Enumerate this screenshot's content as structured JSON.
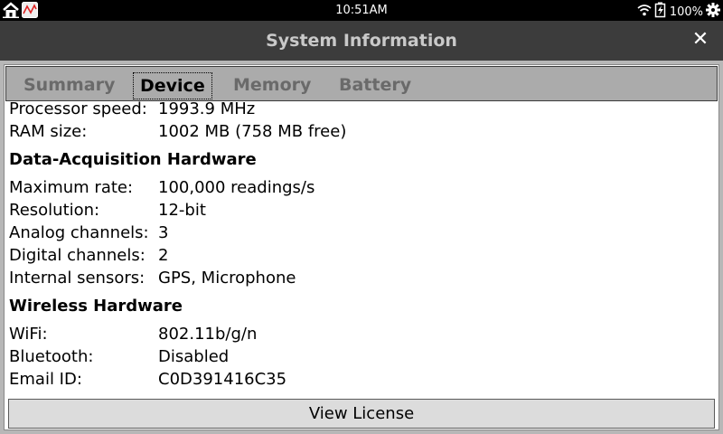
{
  "status_bar": {
    "time": "10:51AM",
    "battery_percent": "100%",
    "icons": [
      "home-icon",
      "chart-app-icon",
      "wifi-icon",
      "battery-charging-icon",
      "gear-icon"
    ]
  },
  "window": {
    "title": "System Information",
    "close_label": "✕"
  },
  "tabs": [
    {
      "label": "Summary",
      "active": false
    },
    {
      "label": "Device",
      "active": true
    },
    {
      "label": "Memory",
      "active": false
    },
    {
      "label": "Battery",
      "active": false
    }
  ],
  "device_info": {
    "processor_speed": {
      "label": "Processor speed:",
      "value": "1993.9 MHz"
    },
    "ram_size": {
      "label": "RAM size:",
      "value": "1002 MB (758 MB free)"
    },
    "daq_heading": "Data-Acquisition Hardware",
    "max_rate": {
      "label": "Maximum rate:",
      "value": "100,000 readings/s"
    },
    "resolution": {
      "label": "Resolution:",
      "value": "12-bit"
    },
    "analog_channels": {
      "label": "Analog channels:",
      "value": "3"
    },
    "digital_channels": {
      "label": "Digital channels:",
      "value": "2"
    },
    "internal_sensors": {
      "label": "Internal sensors:",
      "value": "GPS, Microphone"
    },
    "wireless_heading": "Wireless Hardware",
    "wifi": {
      "label": "WiFi:",
      "value": "802.11b/g/n"
    },
    "bluetooth": {
      "label": "Bluetooth:",
      "value": "Disabled"
    },
    "email_id": {
      "label": "Email ID:",
      "value": "C0D391416C35"
    }
  },
  "buttons": {
    "view_license": "View License"
  }
}
